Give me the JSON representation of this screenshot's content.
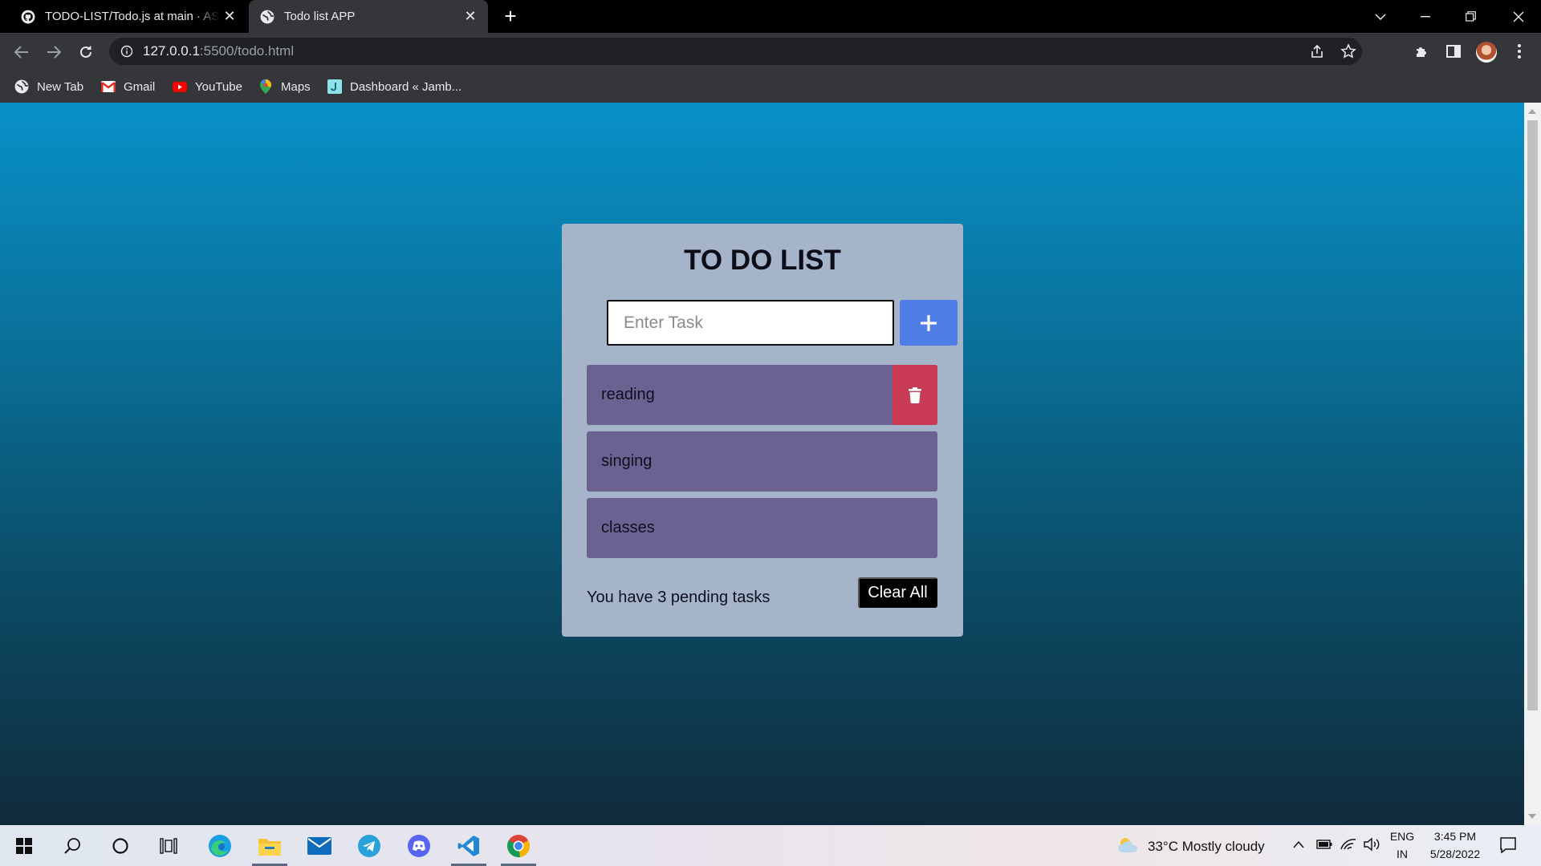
{
  "browser": {
    "tabs": [
      {
        "title": "TODO-LIST/Todo.js at main · ASH",
        "icon": "github-icon",
        "active": false
      },
      {
        "title": "Todo list APP",
        "icon": "globe-icon",
        "active": true
      }
    ],
    "url_host": "127.0.0.1",
    "url_path": ":5500/todo.html",
    "bookmarks": [
      {
        "label": "New Tab",
        "icon": "globe-icon"
      },
      {
        "label": "Gmail",
        "icon": "gmail-icon"
      },
      {
        "label": "YouTube",
        "icon": "youtube-icon"
      },
      {
        "label": "Maps",
        "icon": "maps-icon"
      },
      {
        "label": "Dashboard « Jamb...",
        "icon": "jamboard-icon"
      }
    ]
  },
  "todo": {
    "title": "TO DO LIST",
    "input_placeholder": "Enter Task",
    "input_value": "",
    "tasks": [
      "reading",
      "singing",
      "classes"
    ],
    "pending_text": "You have 3 pending tasks",
    "clear_label": "Clear All",
    "colors": {
      "card": "#a5b4c8",
      "task": "#6b6292",
      "add": "#4f7ee8",
      "delete": "#c93a56"
    }
  },
  "taskbar": {
    "apps": [
      "windows-start-icon",
      "search-icon",
      "cortana-icon",
      "task-view-icon",
      "edge-icon",
      "file-explorer-icon",
      "mail-icon",
      "telegram-icon",
      "discord-icon",
      "vscode-icon",
      "chrome-icon"
    ],
    "weather": "33°C  Mostly cloudy",
    "lang_top": "ENG",
    "lang_bottom": "IN",
    "time": "3:45 PM",
    "date": "5/28/2022"
  }
}
